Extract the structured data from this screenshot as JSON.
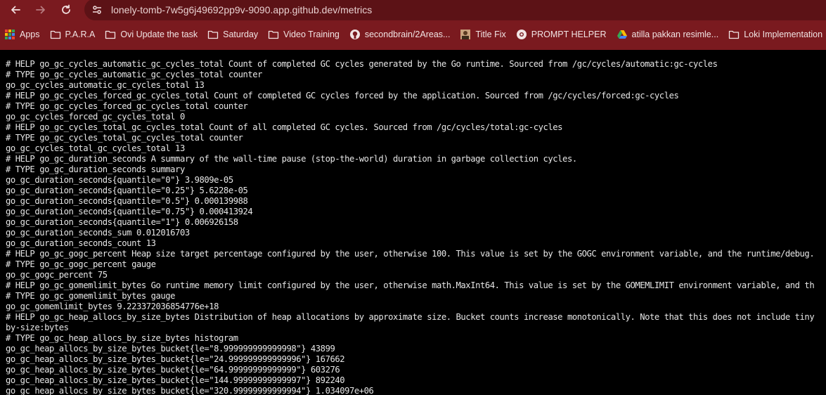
{
  "browser": {
    "url": "lonely-tomb-7w5g6j49692pp9v-9090.app.github.dev/metrics",
    "accent_color": "#7a1a1f",
    "bookmarks": [
      {
        "label": "Apps",
        "icon": "apps-grid-icon"
      },
      {
        "label": "P.A.R.A",
        "icon": "folder-icon"
      },
      {
        "label": "Ovi Update the task",
        "icon": "folder-icon"
      },
      {
        "label": "Saturday",
        "icon": "folder-icon"
      },
      {
        "label": "Video Training",
        "icon": "folder-icon"
      },
      {
        "label": "secondbrain/2Areas...",
        "icon": "github-icon"
      },
      {
        "label": "Title Fix",
        "icon": "avatar-icon"
      },
      {
        "label": "PROMPT HELPER",
        "icon": "chrome-icon"
      },
      {
        "label": "atilla pakkan resimle...",
        "icon": "google-drive-icon"
      },
      {
        "label": "Loki Implementation",
        "icon": "folder-icon"
      }
    ]
  },
  "metrics_lines": [
    "# HELP go_gc_cycles_automatic_gc_cycles_total Count of completed GC cycles generated by the Go runtime. Sourced from /gc/cycles/automatic:gc-cycles",
    "# TYPE go_gc_cycles_automatic_gc_cycles_total counter",
    "go_gc_cycles_automatic_gc_cycles_total 13",
    "# HELP go_gc_cycles_forced_gc_cycles_total Count of completed GC cycles forced by the application. Sourced from /gc/cycles/forced:gc-cycles",
    "# TYPE go_gc_cycles_forced_gc_cycles_total counter",
    "go_gc_cycles_forced_gc_cycles_total 0",
    "# HELP go_gc_cycles_total_gc_cycles_total Count of all completed GC cycles. Sourced from /gc/cycles/total:gc-cycles",
    "# TYPE go_gc_cycles_total_gc_cycles_total counter",
    "go_gc_cycles_total_gc_cycles_total 13",
    "# HELP go_gc_duration_seconds A summary of the wall-time pause (stop-the-world) duration in garbage collection cycles.",
    "# TYPE go_gc_duration_seconds summary",
    "go_gc_duration_seconds{quantile=\"0\"} 3.9809e-05",
    "go_gc_duration_seconds{quantile=\"0.25\"} 5.6228e-05",
    "go_gc_duration_seconds{quantile=\"0.5\"} 0.000139988",
    "go_gc_duration_seconds{quantile=\"0.75\"} 0.000413924",
    "go_gc_duration_seconds{quantile=\"1\"} 0.006926158",
    "go_gc_duration_seconds_sum 0.012016703",
    "go_gc_duration_seconds_count 13",
    "# HELP go_gc_gogc_percent Heap size target percentage configured by the user, otherwise 100. This value is set by the GOGC environment variable, and the runtime/debug.",
    "# TYPE go_gc_gogc_percent gauge",
    "go_gc_gogc_percent 75",
    "# HELP go_gc_gomemlimit_bytes Go runtime memory limit configured by the user, otherwise math.MaxInt64. This value is set by the GOMEMLIMIT environment variable, and th",
    "# TYPE go_gc_gomemlimit_bytes gauge",
    "go_gc_gomemlimit_bytes 9.223372036854776e+18",
    "# HELP go_gc_heap_allocs_by_size_bytes Distribution of heap allocations by approximate size. Bucket counts increase monotonically. Note that this does not include tiny",
    "by-size:bytes",
    "# TYPE go_gc_heap_allocs_by_size_bytes histogram",
    "go_gc_heap_allocs_by_size_bytes_bucket{le=\"8.999999999999998\"} 43899",
    "go_gc_heap_allocs_by_size_bytes_bucket{le=\"24.999999999999996\"} 167662",
    "go_gc_heap_allocs_by_size_bytes_bucket{le=\"64.99999999999999\"} 603276",
    "go_gc_heap_allocs_by_size_bytes_bucket{le=\"144.99999999999997\"} 892240",
    "go_gc_heap_allocs_by_size_bytes_bucket{le=\"320.99999999999994\"} 1.034097e+06"
  ]
}
